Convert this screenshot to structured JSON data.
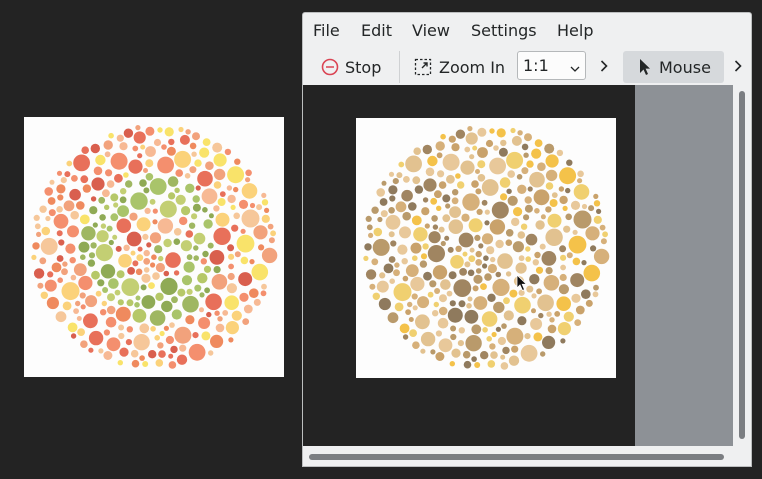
{
  "menu": {
    "file": "File",
    "edit": "Edit",
    "view": "View",
    "settings": "Settings",
    "help": "Help"
  },
  "toolbar": {
    "stop_label": "Stop",
    "zoom_in_label": "Zoom In",
    "zoom_value": "1:1",
    "mouse_label": "Mouse"
  },
  "colors": {
    "desktop_bg": "#232323",
    "window_bg": "#eff0f1",
    "active_button": "#d6d9dc",
    "side_pane": "#8d9196",
    "stop_red": "#da4453"
  },
  "icons": {
    "stop": "stop-icon",
    "zoom_in": "zoom-in-icon",
    "dropdown": "chevron-down-icon",
    "overflow": "chevron-right-icon",
    "mouse": "mouse-pointer-icon"
  }
}
